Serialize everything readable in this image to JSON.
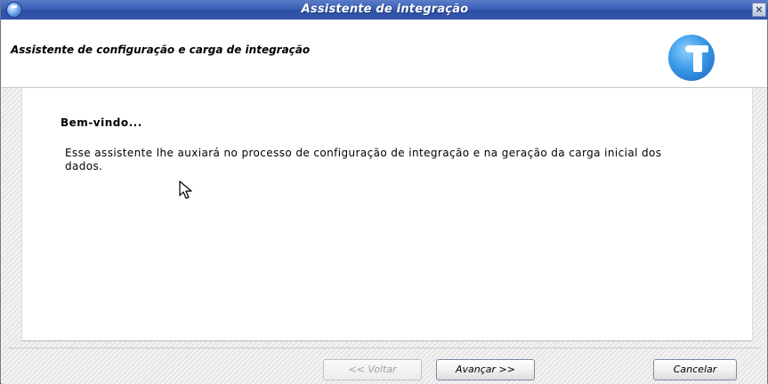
{
  "window": {
    "title": "Assistente de integração",
    "close_label": "×"
  },
  "header": {
    "title": "Assistente de configuração e carga de integração"
  },
  "content": {
    "welcome": "Bem-vindo...",
    "description": "Esse assistente lhe auxiará no processo de configuração de integração e na geração da carga inicial dos dados."
  },
  "buttons": {
    "back": "<< Voltar",
    "next": "Avançar >>",
    "cancel": "Cancelar"
  },
  "colors": {
    "titlebar": "#3a5fb5",
    "logo": "#3a9be8"
  },
  "icons": [
    "app-icon",
    "close-icon",
    "logo-icon",
    "mouse-pointer-icon"
  ]
}
